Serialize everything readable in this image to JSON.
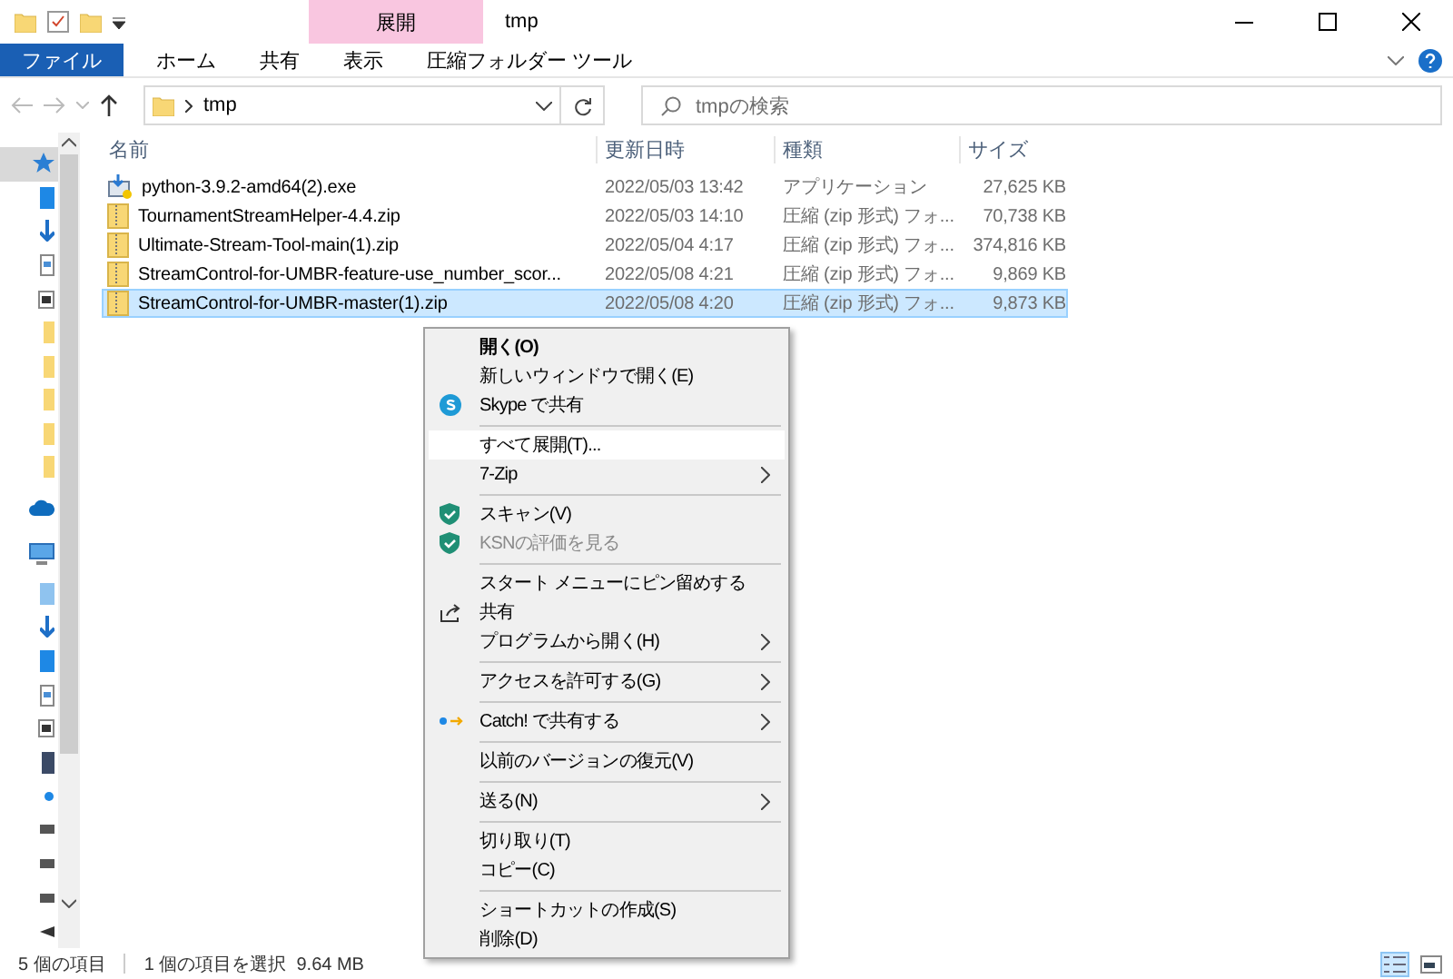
{
  "title_bar": {
    "contextual_tab": "展開",
    "title": "tmp"
  },
  "ribbon_tabs": [
    {
      "label": "ファイル",
      "kind": "file"
    },
    {
      "label": "ホーム",
      "kind": "tab"
    },
    {
      "label": "共有",
      "kind": "tab"
    },
    {
      "label": "表示",
      "kind": "tab"
    },
    {
      "label": "圧縮フォルダー ツール",
      "kind": "tab"
    }
  ],
  "address": {
    "path": "tmp"
  },
  "search": {
    "placeholder": "tmpの検索"
  },
  "nav_items": [
    {
      "kind": "star",
      "selected": true
    },
    {
      "kind": "desktop",
      "selected": false
    },
    {
      "kind": "download",
      "selected": false
    },
    {
      "kind": "doc",
      "selected": false
    },
    {
      "kind": "picture",
      "selected": false
    },
    {
      "kind": "folder",
      "selected": false
    },
    {
      "kind": "folder",
      "selected": false
    },
    {
      "kind": "folder",
      "selected": false
    },
    {
      "kind": "folder",
      "selected": false
    },
    {
      "kind": "folder",
      "selected": false
    },
    {
      "kind": "cloud",
      "selected": false
    },
    {
      "kind": "pc",
      "selected": false
    },
    {
      "kind": "object",
      "selected": false
    },
    {
      "kind": "download",
      "selected": false
    },
    {
      "kind": "desktop",
      "selected": false
    },
    {
      "kind": "doc",
      "selected": false
    },
    {
      "kind": "picture",
      "selected": false
    },
    {
      "kind": "video",
      "selected": false
    },
    {
      "kind": "music",
      "selected": false
    },
    {
      "kind": "drive",
      "selected": false
    },
    {
      "kind": "drive",
      "selected": false
    },
    {
      "kind": "drive",
      "selected": false
    },
    {
      "kind": "network",
      "selected": false
    }
  ],
  "table": {
    "columns": [
      "名前",
      "更新日時",
      "種類",
      "サイズ"
    ],
    "rows": [
      {
        "kind": "exe",
        "name": "python-3.9.2-amd64(2).exe",
        "date": "2022/05/03 13:42",
        "type": "アプリケーション",
        "size": "27,625 KB",
        "selected": false
      },
      {
        "kind": "zip",
        "name": "TournamentStreamHelper-4.4.zip",
        "date": "2022/05/03 14:10",
        "type": "圧縮 (zip 形式) フォ...",
        "size": "70,738 KB",
        "selected": false
      },
      {
        "kind": "zip",
        "name": "Ultimate-Stream-Tool-main(1).zip",
        "date": "2022/05/04 4:17",
        "type": "圧縮 (zip 形式) フォ...",
        "size": "374,816 KB",
        "selected": false
      },
      {
        "kind": "zip",
        "name": "StreamControl-for-UMBR-feature-use_number_scor...",
        "date": "2022/05/08 4:21",
        "type": "圧縮 (zip 形式) フォ...",
        "size": "9,869 KB",
        "selected": false
      },
      {
        "kind": "zip",
        "name": "StreamControl-for-UMBR-master(1).zip",
        "date": "2022/05/08 4:20",
        "type": "圧縮 (zip 形式) フォ...",
        "size": "9,873 KB",
        "selected": true
      }
    ]
  },
  "context_menu": [
    {
      "kind": "item",
      "label": "開く(O)",
      "bold": true,
      "submenu": false,
      "disabled": false,
      "selected": false
    },
    {
      "kind": "item",
      "label": "新しいウィンドウで開く(E)",
      "bold": false,
      "submenu": false,
      "disabled": false,
      "selected": false
    },
    {
      "kind": "skype",
      "label": "Skype で共有",
      "bold": false,
      "submenu": false,
      "disabled": false,
      "selected": false
    },
    {
      "kind": "separator"
    },
    {
      "kind": "item",
      "label": "すべて展開(T)...",
      "bold": false,
      "submenu": false,
      "disabled": false,
      "selected": true
    },
    {
      "kind": "item",
      "label": "7-Zip",
      "bold": false,
      "submenu": true,
      "disabled": false,
      "selected": false
    },
    {
      "kind": "separator"
    },
    {
      "kind": "shield",
      "label": "スキャン(V)",
      "bold": false,
      "submenu": false,
      "disabled": false,
      "selected": false
    },
    {
      "kind": "shield",
      "label": "KSNの評価を見る",
      "bold": false,
      "submenu": false,
      "disabled": true,
      "selected": false
    },
    {
      "kind": "separator"
    },
    {
      "kind": "item",
      "label": "スタート メニューにピン留めする",
      "bold": false,
      "submenu": false,
      "disabled": false,
      "selected": false
    },
    {
      "kind": "share",
      "label": "共有",
      "bold": false,
      "submenu": false,
      "disabled": false,
      "selected": false
    },
    {
      "kind": "item",
      "label": "プログラムから開く(H)",
      "bold": false,
      "submenu": true,
      "disabled": false,
      "selected": false
    },
    {
      "kind": "separator"
    },
    {
      "kind": "item",
      "label": "アクセスを許可する(G)",
      "bold": false,
      "submenu": true,
      "disabled": false,
      "selected": false
    },
    {
      "kind": "separator"
    },
    {
      "kind": "catch",
      "label": "Catch! で共有する",
      "bold": false,
      "submenu": true,
      "disabled": false,
      "selected": false
    },
    {
      "kind": "separator"
    },
    {
      "kind": "item",
      "label": "以前のバージョンの復元(V)",
      "bold": false,
      "submenu": false,
      "disabled": false,
      "selected": false
    },
    {
      "kind": "separator"
    },
    {
      "kind": "item",
      "label": "送る(N)",
      "bold": false,
      "submenu": true,
      "disabled": false,
      "selected": false
    },
    {
      "kind": "separator"
    },
    {
      "kind": "item",
      "label": "切り取り(T)",
      "bold": false,
      "submenu": false,
      "disabled": false,
      "selected": false
    },
    {
      "kind": "item",
      "label": "コピー(C)",
      "bold": false,
      "submenu": false,
      "disabled": false,
      "selected": false
    },
    {
      "kind": "separator"
    },
    {
      "kind": "item",
      "label": "ショートカットの作成(S)",
      "bold": false,
      "submenu": false,
      "disabled": false,
      "selected": false
    },
    {
      "kind": "item",
      "label": "削除(D)",
      "bold": false,
      "submenu": false,
      "disabled": false,
      "selected": false
    }
  ],
  "status_bar": {
    "count": "5 個の項目",
    "selection": "1 個の項目を選択  9.64 MB"
  },
  "view_buttons": [
    {
      "kind": "details",
      "selected": true
    },
    {
      "kind": "tiles",
      "selected": false
    }
  ]
}
